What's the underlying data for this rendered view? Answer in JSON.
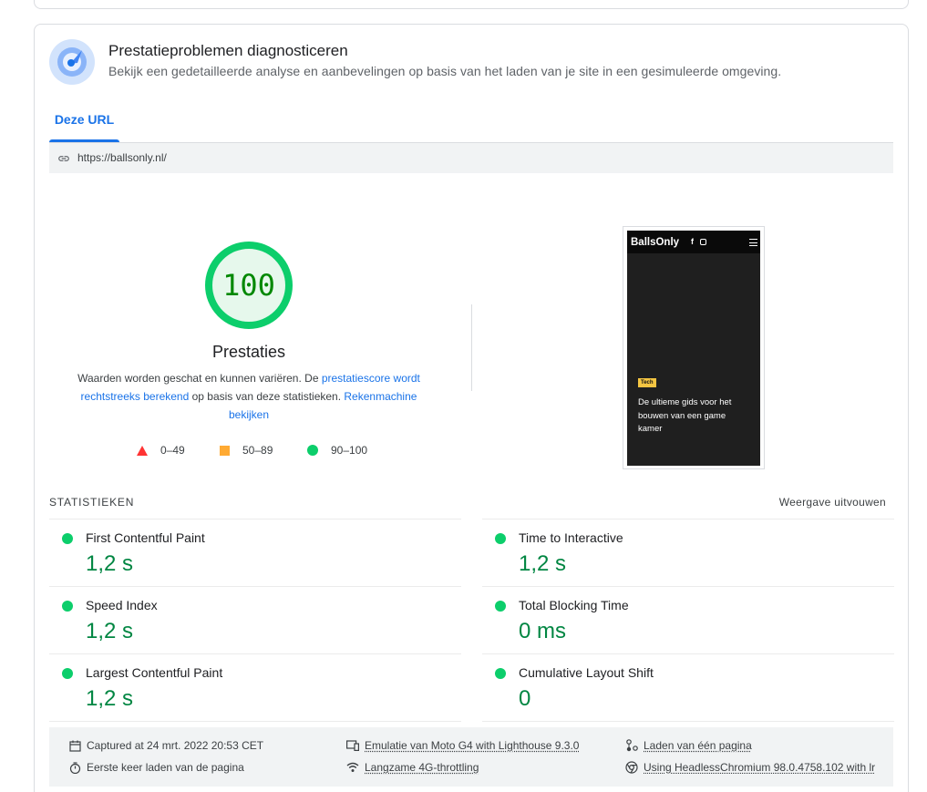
{
  "card": {
    "title": "Prestatieproblemen diagnosticeren",
    "subtitle": "Bekijk een gedetailleerde analyse en aanbevelingen op basis van het laden van je site in een gesimuleerde omgeving."
  },
  "tabs": [
    {
      "label": "Deze URL",
      "active": true
    }
  ],
  "url": "https://ballsonly.nl/",
  "score": {
    "value": "100",
    "fraction": 1.0,
    "label": "Prestaties",
    "desc_before": "Waarden worden geschat en kunnen variëren. De ",
    "desc_link1": "prestatiescore wordt rechtstreeks berekend",
    "desc_middle": " op basis van deze statistieken. ",
    "desc_link2": "Rekenmachine bekijken",
    "color": "#0cce6b"
  },
  "legend": [
    {
      "range": "0–49",
      "shape": "triangle",
      "color": "#ff3333"
    },
    {
      "range": "50–89",
      "shape": "square",
      "color": "#ffaa33"
    },
    {
      "range": "90–100",
      "shape": "circle",
      "color": "#0cce6b"
    }
  ],
  "preview": {
    "brand": "BallsOnly",
    "fb": "f",
    "tag": "Tech",
    "headline": "De ultieme gids voor het bouwen van een game kamer"
  },
  "stats": {
    "heading": "STATISTIEKEN",
    "expand": "Weergave uitvouwen",
    "metrics": [
      {
        "name": "First Contentful Paint",
        "value": "1,2 s"
      },
      {
        "name": "Time to Interactive",
        "value": "1,2 s"
      },
      {
        "name": "Speed Index",
        "value": "1,2 s"
      },
      {
        "name": "Total Blocking Time",
        "value": "0 ms"
      },
      {
        "name": "Largest Contentful Paint",
        "value": "1,2 s"
      },
      {
        "name": "Cumulative Layout Shift",
        "value": "0"
      }
    ]
  },
  "footer": {
    "captured": "Captured at 24 mrt. 2022 20:53 CET",
    "first_load": "Eerste keer laden van de pagina",
    "emulation": "Emulatie van Moto G4 with Lighthouse 9.3.0",
    "throttling": "Langzame 4G-throttling",
    "single_load": "Laden van één pagina",
    "browser": "Using HeadlessChromium 98.0.4758.102 with lr"
  },
  "colors": {
    "accent": "#1a73e8",
    "pass": "#0cce6b",
    "pass_text": "#018642"
  }
}
